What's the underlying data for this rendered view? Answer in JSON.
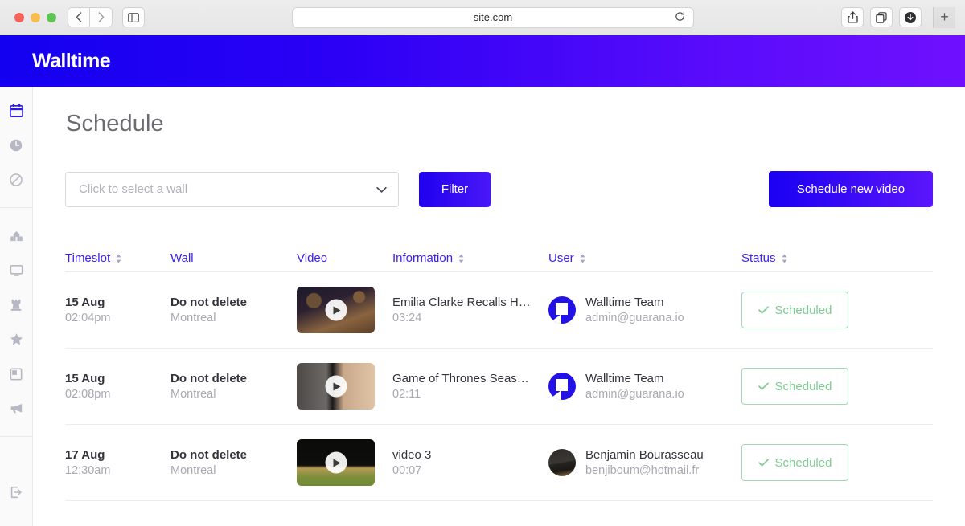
{
  "browser": {
    "url": "site.com",
    "back_icon": "chevron-left-icon",
    "forward_icon": "chevron-right-icon",
    "sidebar_icon": "sidebar-toggle-icon",
    "reload_icon": "reload-icon",
    "share_icon": "share-icon",
    "tabs_icon": "tab-overview-icon",
    "downloads_icon": "downloads-icon",
    "new_tab_label": "+"
  },
  "header": {
    "logo": "Walltime",
    "gradient_from": "#1400f0",
    "gradient_to": "#6f10ff"
  },
  "sidebar": {
    "items": [
      {
        "name": "sidebar-item-calendar",
        "icon": "calendar-icon",
        "active": true
      },
      {
        "name": "sidebar-item-history",
        "icon": "clock-icon",
        "active": false
      },
      {
        "name": "sidebar-item-blocked",
        "icon": "ban-icon",
        "active": false
      },
      {
        "name": "sidebar-item-venue",
        "icon": "building-icon",
        "active": false
      },
      {
        "name": "sidebar-item-screens",
        "icon": "monitor-icon",
        "active": false
      },
      {
        "name": "sidebar-item-tower",
        "icon": "chess-rook-icon",
        "active": false
      },
      {
        "name": "sidebar-item-favorites",
        "icon": "star-icon",
        "active": false
      },
      {
        "name": "sidebar-item-layout",
        "icon": "picture-in-picture-icon",
        "active": false
      },
      {
        "name": "sidebar-item-announcements",
        "icon": "megaphone-icon",
        "active": false
      },
      {
        "name": "sidebar-item-logout",
        "icon": "logout-icon",
        "active": false
      }
    ]
  },
  "page": {
    "title": "Schedule"
  },
  "controls": {
    "wall_select_placeholder": "Click to select a wall",
    "wall_select_value": "",
    "wall_select_chevron": "chevron-down-icon",
    "filter_label": "Filter",
    "schedule_label": "Schedule new video",
    "accent": "#2b19f5"
  },
  "table": {
    "columns": [
      {
        "label": "Timeslot",
        "sortable": true
      },
      {
        "label": "Wall",
        "sortable": false
      },
      {
        "label": "Video",
        "sortable": false
      },
      {
        "label": "Information",
        "sortable": true
      },
      {
        "label": "User",
        "sortable": true
      },
      {
        "label": "Status",
        "sortable": true
      }
    ],
    "rows": [
      {
        "date": "15 Aug",
        "time": "02:04pm",
        "wall_name": "Do not delete",
        "wall_city": "Montreal",
        "thumb_class": "th1",
        "video_title": "Emilia Clarke Recalls H…",
        "video_duration": "03:24",
        "user_name": "Walltime Team",
        "user_email": "admin@guarana.io",
        "avatar_type": "brand",
        "status": "Scheduled",
        "status_icon": "check-icon"
      },
      {
        "date": "15 Aug",
        "time": "02:08pm",
        "wall_name": "Do not delete",
        "wall_city": "Montreal",
        "thumb_class": "th2",
        "video_title": "Game of Thrones Seas…",
        "video_duration": "02:11",
        "user_name": "Walltime Team",
        "user_email": "admin@guarana.io",
        "avatar_type": "brand",
        "status": "Scheduled",
        "status_icon": "check-icon"
      },
      {
        "date": "17 Aug",
        "time": "12:30am",
        "wall_name": "Do not delete",
        "wall_city": "Montreal",
        "thumb_class": "th3",
        "video_title": "video 3",
        "video_duration": "00:07",
        "user_name": "Benjamin Bourasseau",
        "user_email": "benjiboum@hotmail.fr",
        "avatar_type": "photo",
        "status": "Scheduled",
        "status_icon": "check-icon"
      }
    ]
  }
}
